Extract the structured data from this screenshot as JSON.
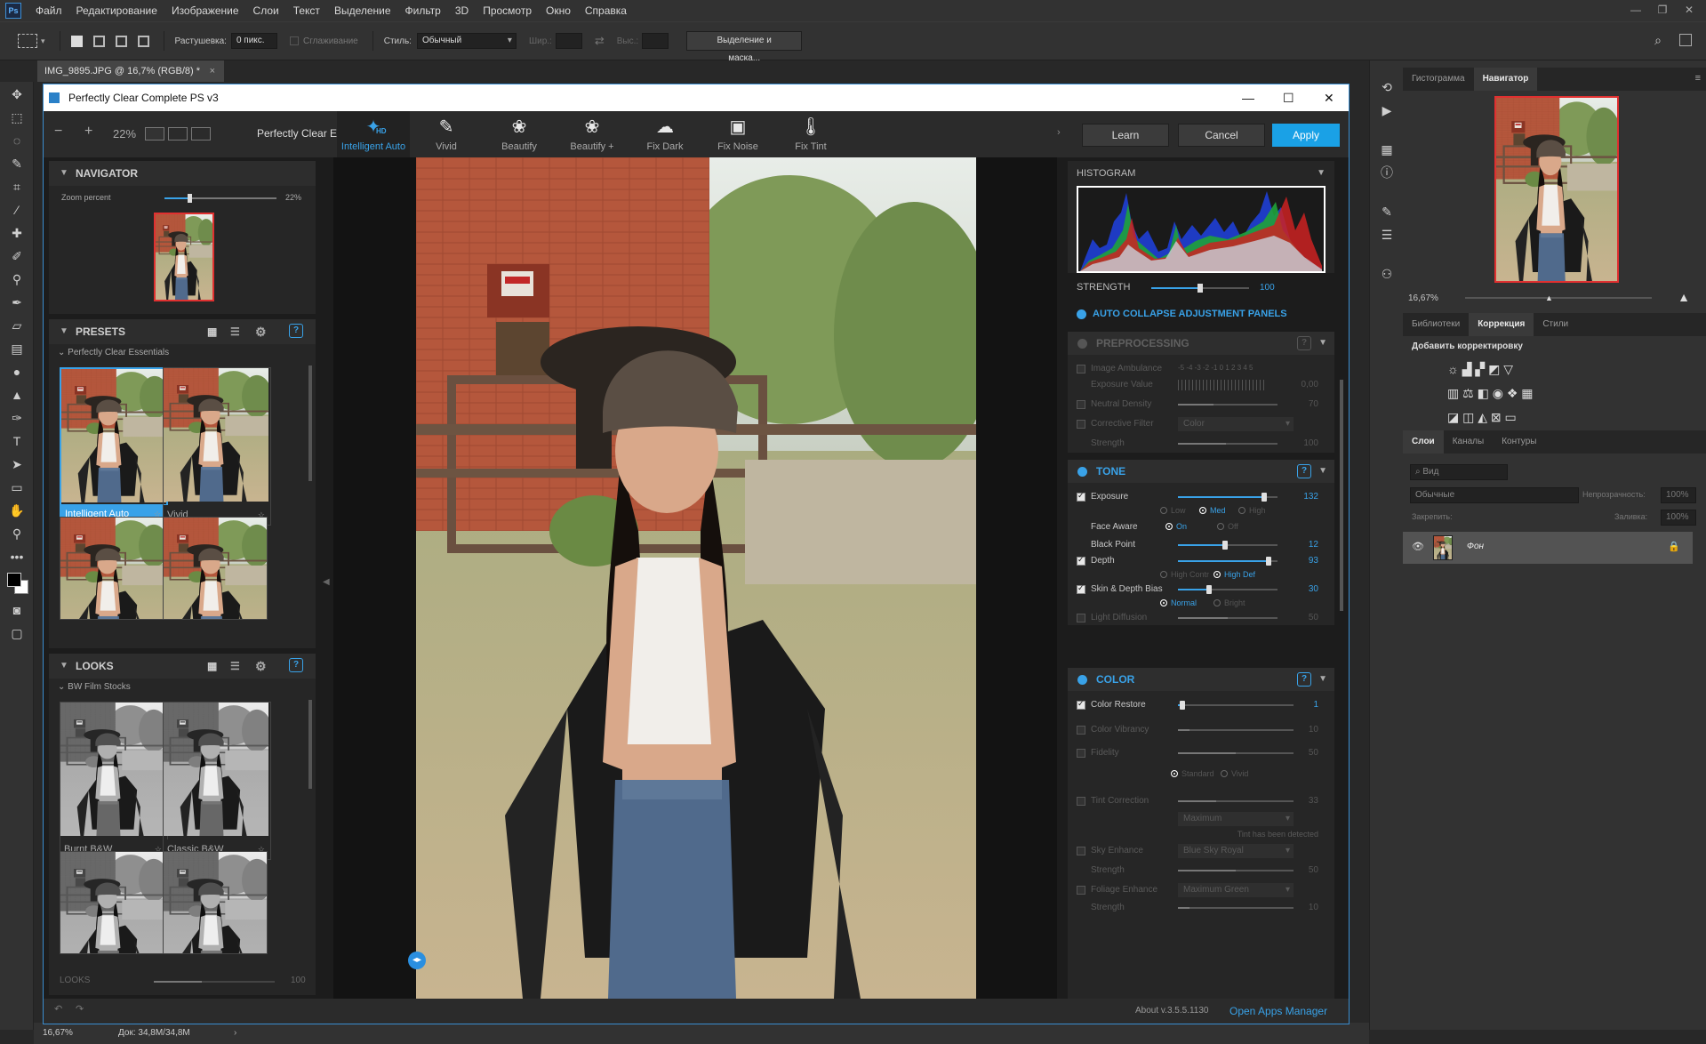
{
  "ps": {
    "logo": "Ps",
    "menu": [
      "Файл",
      "Редактирование",
      "Изображение",
      "Слои",
      "Текст",
      "Выделение",
      "Фильтр",
      "3D",
      "Просмотр",
      "Окно",
      "Справка"
    ],
    "options": {
      "feather_label": "Растушевка:",
      "feather_value": "0 пикс.",
      "antialias": "Сглаживание",
      "style_label": "Стиль:",
      "style_value": "Обычный",
      "width_label": "Шир.:",
      "height_label": "Выс.:",
      "select_mask": "Выделение и маска..."
    },
    "doc_tab": "IMG_9895.JPG @ 16,7% (RGB/8) *",
    "status": {
      "zoom": "16,67%",
      "doc": "Док: 34,8M/34,8M"
    },
    "panels": {
      "tabs_top": [
        "Гистограмма",
        "Навигатор"
      ],
      "nav_zoom": "16,67%",
      "tabs_mid": [
        "Библиотеки",
        "Коррекция",
        "Стили"
      ],
      "add_adjust": "Добавить корректировку",
      "tabs_layers": [
        "Слои",
        "Каналы",
        "Контуры"
      ],
      "kind": "Вид",
      "blend": "Обычные",
      "opacity_label": "Непрозрачность:",
      "opacity": "100%",
      "lock_label": "Закрепить:",
      "fill_label": "Заливка:",
      "fill": "100%",
      "layer_name": "Фон"
    }
  },
  "plugin": {
    "title": "Perfectly Clear Complete PS v3",
    "zoom": "22%",
    "preset_name": "Perfectly Clear Essentials",
    "tools": [
      {
        "label": "Intelligent Auto",
        "badge": "HD"
      },
      {
        "label": "Vivid"
      },
      {
        "label": "Beautify"
      },
      {
        "label": "Beautify +"
      },
      {
        "label": "Fix Dark"
      },
      {
        "label": "Fix Noise"
      },
      {
        "label": "Fix Tint"
      }
    ],
    "buttons": {
      "learn": "Learn",
      "cancel": "Cancel",
      "apply": "Apply"
    },
    "navigator": {
      "title": "NAVIGATOR",
      "zoom_label": "Zoom percent",
      "zoom_value": "22%",
      "zoom_level": 0.22
    },
    "presets": {
      "title": "PRESETS",
      "group": "Perfectly Clear Essentials",
      "items": [
        "Intelligent Auto",
        "Vivid",
        "",
        ""
      ]
    },
    "looks": {
      "title": "LOOKS",
      "group": "BW Film Stocks",
      "items": [
        "Burnt B&W",
        "Classic B&W",
        "",
        ""
      ],
      "strength_label": "LOOKS",
      "strength_value": "100"
    },
    "histogram": {
      "title": "HISTOGRAM"
    },
    "strength": {
      "label": "STRENGTH",
      "value": "100",
      "level": 1.0
    },
    "auto_collapse": "AUTO COLLAPSE ADJUSTMENT PANELS",
    "preprocessing": {
      "title": "PREPROCESSING",
      "ambulance_label": "Image Ambulance",
      "ambulance_scale": "-5 -4 -3 -2 -1 0 1 2 3 4 5",
      "exposure_value_label": "Exposure Value",
      "exposure_value": "0,00",
      "neutral_density_label": "Neutral Density",
      "neutral_density": "70",
      "corrective_filter_label": "Corrective Filter",
      "corrective_filter": "Color",
      "strength_label": "Strength",
      "strength": "100"
    },
    "tone": {
      "title": "TONE",
      "exposure_label": "Exposure",
      "exposure": "132",
      "exp_modes": [
        "Low",
        "Med",
        "High"
      ],
      "face_aware_label": "Face Aware",
      "face_modes": [
        "On",
        "Off"
      ],
      "black_point_label": "Black Point",
      "black_point": "12",
      "depth_label": "Depth",
      "depth": "93",
      "depth_modes": [
        "High Contr",
        "High Def"
      ],
      "skin_label": "Skin & Depth Bias",
      "skin": "30",
      "skin_modes": [
        "Normal",
        "Bright"
      ],
      "light_diffusion_label": "Light Diffusion",
      "light_diffusion": "50"
    },
    "color": {
      "title": "COLOR",
      "restore_label": "Color Restore",
      "restore": "1",
      "vibrancy_label": "Color Vibrancy",
      "vibrancy": "10",
      "fidelity_label": "Fidelity",
      "fidelity": "50",
      "fidelity_modes": [
        "Standard",
        "Vivid"
      ],
      "tint_label": "Tint Correction",
      "tint": "33",
      "tint_mode": "Maximum",
      "tint_note": "Tint has been detected",
      "sky_label": "Sky Enhance",
      "sky_mode": "Blue Sky Royal",
      "sky_strength_label": "Strength",
      "sky_strength": "50",
      "foliage_label": "Foliage Enhance",
      "foliage_mode": "Maximum Green",
      "foliage_strength_label": "Strength",
      "foliage_strength": "10"
    },
    "footer": {
      "about": "About v.3.5.5.1130",
      "apps": "Open Apps Manager"
    }
  }
}
